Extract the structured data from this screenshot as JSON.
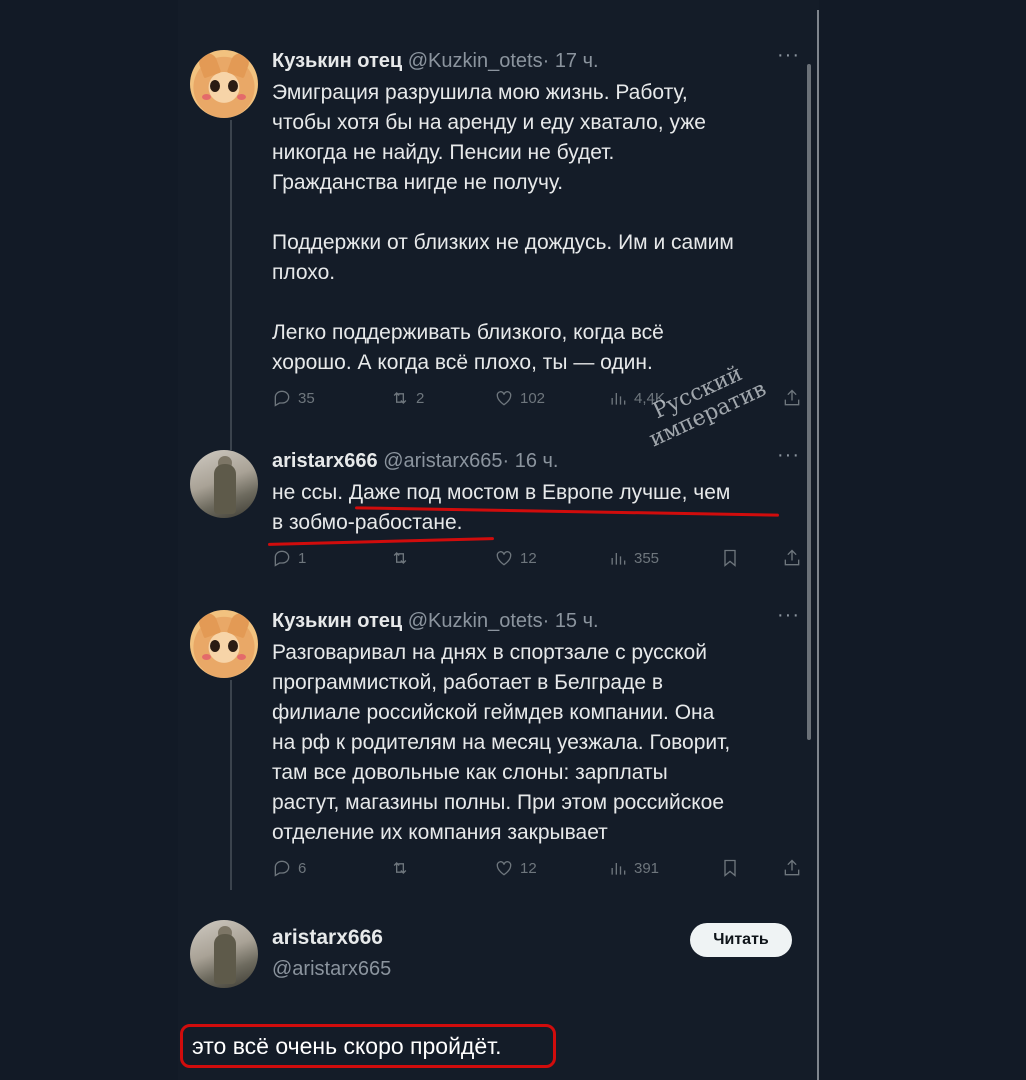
{
  "tweets": [
    {
      "name": "Кузькин отец",
      "handle": "@Kuzkin_otets",
      "time": "17 ч.",
      "text": "Эмиграция разрушила мою жизнь. Работу,\nчтобы хотя бы на аренду и еду хватало, уже\nникогда не найду. Пенсии не будет.\nГражданства нигде не получу.\n\nПоддержки от близких не дождусь. Им и самим\nплохо.\n\nЛегко поддерживать близкого, когда всё\nхорошо. А когда всё плохо, ты — один.",
      "replies": "35",
      "reposts": "2",
      "likes": "102",
      "views": "4,4K"
    },
    {
      "name": "aristarx666",
      "handle": "@aristarx665",
      "time": "16 ч.",
      "text": "не ссы. Даже под мостом в Европе лучше, чем\nв зобмо-рабостане.",
      "replies": "1",
      "likes": "12",
      "views": "355"
    },
    {
      "name": "Кузькин отец",
      "handle": "@Kuzkin_otets",
      "time": "15 ч.",
      "text": "Разговаривал на днях в спортзале с русской\nпрограммисткой, работает в Белграде в\nфилиале российской геймдев компании. Она\nна рф к родителям на месяц уезжала. Говорит,\nтам все довольные как слоны: зарплаты\nрастут, магазины полны. При этом российское\nотделение их компания закрывает",
      "replies": "6",
      "likes": "12",
      "views": "391"
    }
  ],
  "main_post": {
    "name": "aristarx666",
    "handle": "@aristarx665",
    "follow_label": "Читать",
    "text": "это всё очень скоро пройдёт."
  },
  "separator": "·",
  "watermark": "Русский\nимператив",
  "annotation_color": "#d10c0c"
}
